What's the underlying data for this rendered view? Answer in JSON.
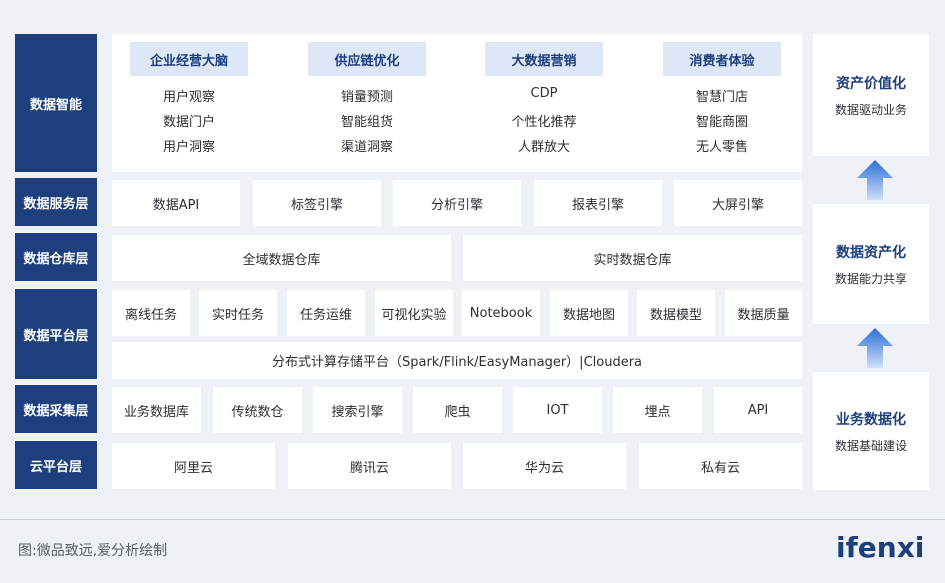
{
  "layers": {
    "intelligence": "数据智能",
    "service": "数据服务层",
    "warehouse": "数据仓库层",
    "platform": "数据平台层",
    "collection": "数据采集层",
    "cloud": "云平台层"
  },
  "intelligence_groups": [
    {
      "title": "企业经营大脑",
      "items": [
        "用户观察",
        "数据门户",
        "用户洞察"
      ]
    },
    {
      "title": "供应链优化",
      "items": [
        "销量预测",
        "智能组货",
        "渠道洞察"
      ]
    },
    {
      "title": "大数据营销",
      "items": [
        "CDP",
        "个性化推荐",
        "人群放大"
      ]
    },
    {
      "title": "消费者体验",
      "items": [
        "智慧门店",
        "智能商圈",
        "无人零售"
      ]
    }
  ],
  "service_items": [
    "数据API",
    "标签引擎",
    "分析引擎",
    "报表引擎",
    "大屏引擎"
  ],
  "warehouse_items": [
    "全域数据仓库",
    "实时数据仓库"
  ],
  "platform_items": [
    "离线任务",
    "实时任务",
    "任务运维",
    "可视化实验",
    "Notebook",
    "数据地图",
    "数据模型",
    "数据质量"
  ],
  "platform_bar": "分布式计算存储平台（Spark/Flink/EasyManager）|Cloudera",
  "collection_items": [
    "业务数据库",
    "传统数仓",
    "搜索引擎",
    "爬虫",
    "IOT",
    "埋点",
    "API"
  ],
  "cloud_items": [
    "阿里云",
    "腾讯云",
    "华为云",
    "私有云"
  ],
  "side": [
    {
      "title": "资产价值化",
      "sub": "数据驱动业务"
    },
    {
      "title": "数据资产化",
      "sub": "数据能力共享"
    },
    {
      "title": "业务数据化",
      "sub": "数据基础建设"
    }
  ],
  "footer": {
    "caption": "图:微品致远,爱分析绘制",
    "logo": "ifenxi"
  },
  "colors": {
    "navy": "#1d3f7e",
    "arrow": "#2b6fd6",
    "header_bg": "#dde7f6"
  }
}
